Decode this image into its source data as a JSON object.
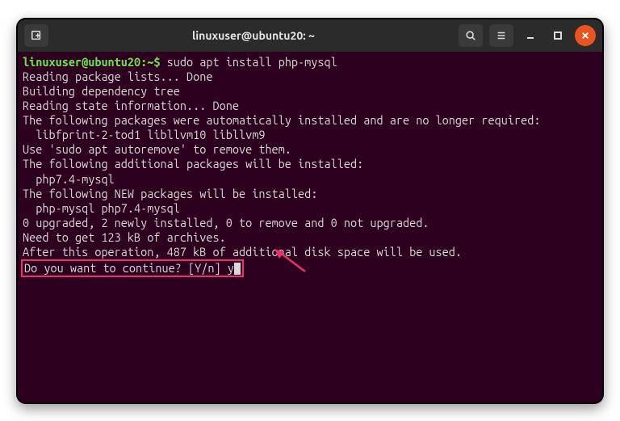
{
  "titlebar": {
    "title": "linuxuser@ubuntu20: ~"
  },
  "terminal": {
    "prompt": "linuxuser@ubuntu20:~$",
    "command": "sudo apt install php-mysql",
    "lines": [
      "Reading package lists... Done",
      "Building dependency tree",
      "Reading state information... Done",
      "The following packages were automatically installed and are no longer required:",
      "  libfprint-2-tod1 libllvm10 libllvm9",
      "Use 'sudo apt autoremove' to remove them.",
      "The following additional packages will be installed:",
      "  php7.4-mysql",
      "The following NEW packages will be installed:",
      "  php-mysql php7.4-mysql",
      "0 upgraded, 2 newly installed, 0 to remove and 0 not upgraded.",
      "Need to get 123 kB of archives.",
      "After this operation, 487 kB of additional disk space will be used."
    ],
    "highlight_prompt": "Do you want to continue? [Y/n] y"
  },
  "colors": {
    "terminal_bg": "#2c001e",
    "prompt_green": "#6fe04a",
    "highlight_border": "#ef2f6b",
    "close_orange": "#e95420"
  }
}
